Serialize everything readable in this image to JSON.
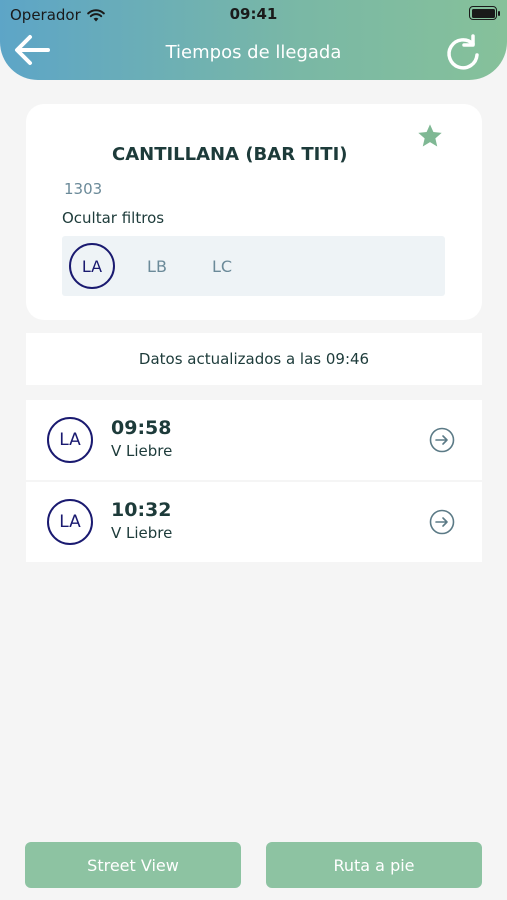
{
  "status_bar": {
    "carrier": "Operador",
    "time": "09:41"
  },
  "header": {
    "title": "Tiempos de llegada",
    "back_icon": "arrow-left-icon",
    "refresh_icon": "refresh-icon"
  },
  "stop": {
    "name": "CANTILLANA (BAR TITI)",
    "code": "1303",
    "filter_toggle": "Ocultar filtros",
    "favorite_icon": "star-icon",
    "filters": [
      {
        "label": "LA",
        "selected": true
      },
      {
        "label": "LB",
        "selected": false
      },
      {
        "label": "LC",
        "selected": false
      }
    ]
  },
  "updated": {
    "text": "Datos actualizados a las 09:46"
  },
  "arrivals": [
    {
      "line": "LA",
      "time": "09:58",
      "destination": "V Liebre"
    },
    {
      "line": "LA",
      "time": "10:32",
      "destination": "V Liebre"
    }
  ],
  "actions": {
    "street_view": "Street View",
    "walk_route": "Ruta a pie"
  },
  "colors": {
    "accent": "#86c19a",
    "line": "#1a1a70",
    "header_start": "#5da5c7",
    "header_end": "#86c19a"
  }
}
